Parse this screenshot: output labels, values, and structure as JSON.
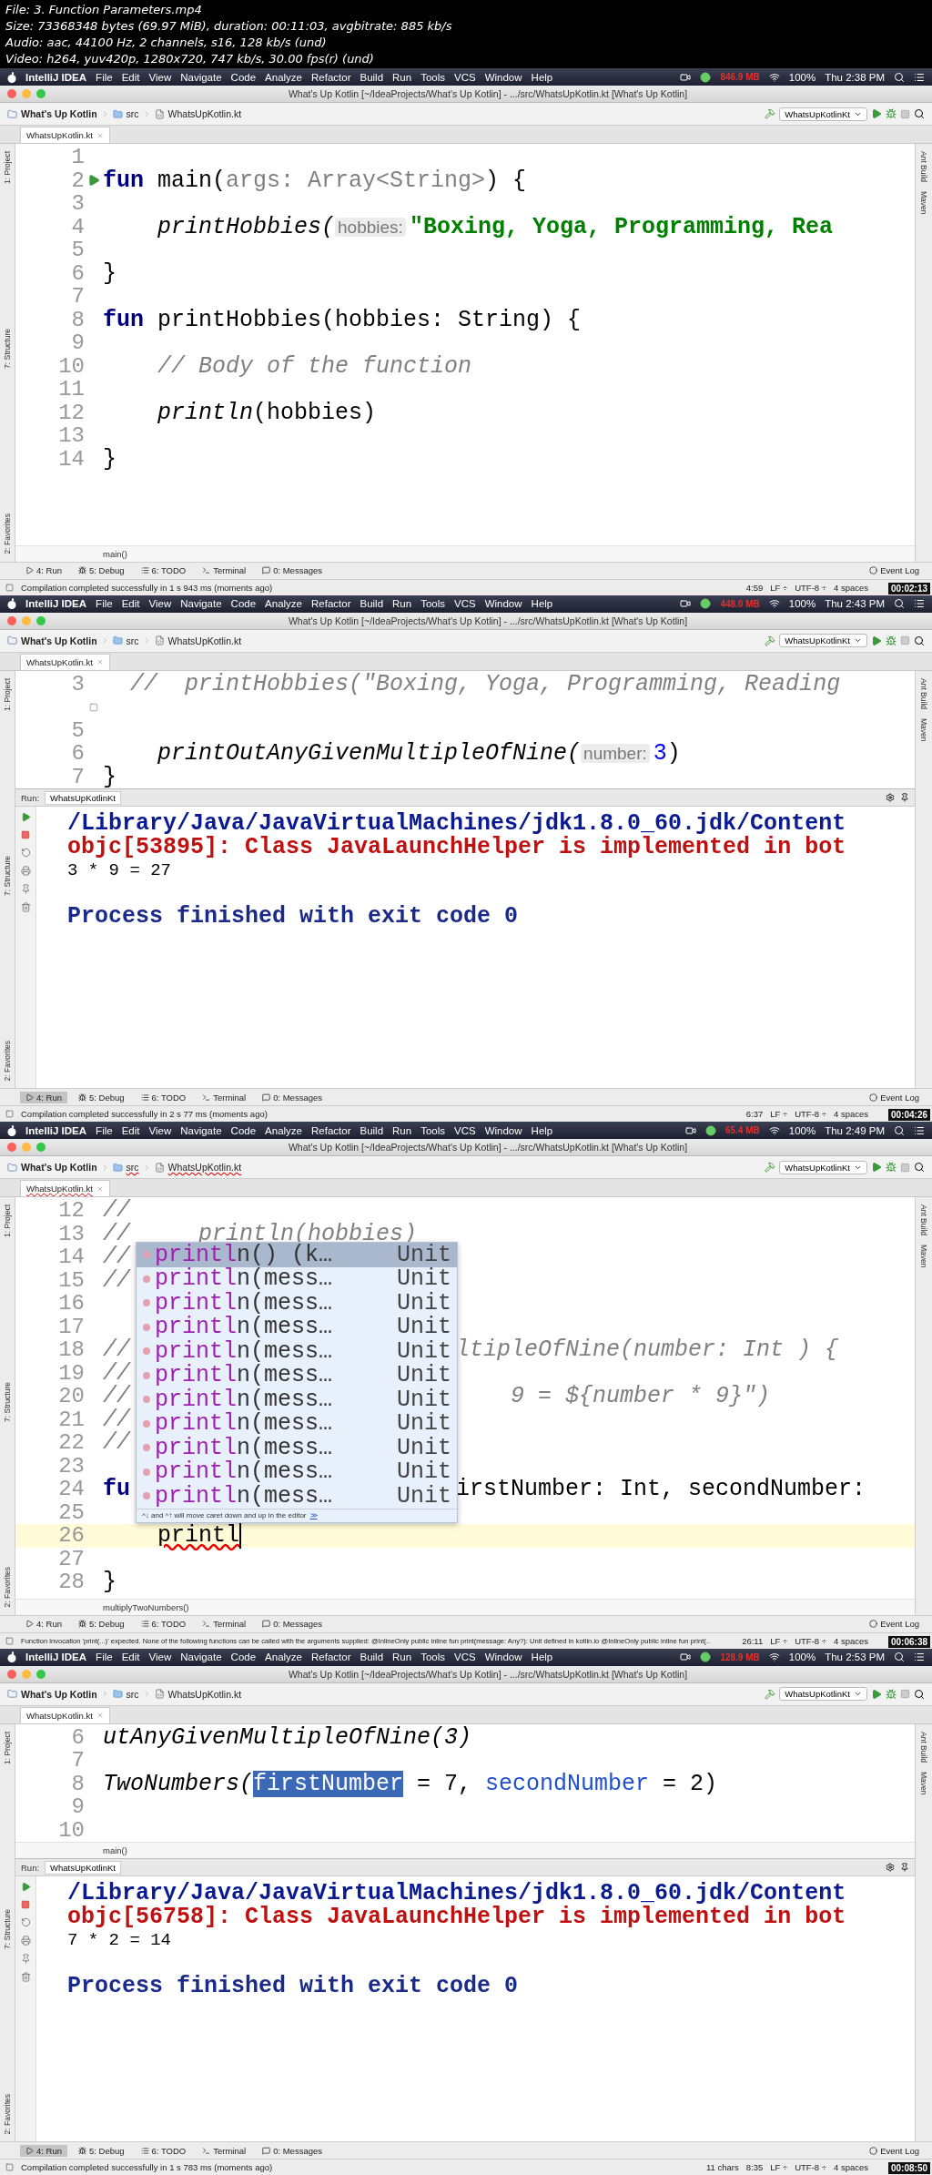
{
  "file_info": [
    "File: 3. Function Parameters.mp4",
    "Size: 73368348 bytes (69.97 MiB), duration: 00:11:03, avgbitrate: 885 kb/s",
    "Audio: aac, 44100 Hz, 2 channels, s16, 128 kb/s (und)",
    "Video: h264, yuv420p, 1280x720, 747 kb/s, 30.00 fps(r) (und)"
  ],
  "frames": [
    {
      "menu_bar": {
        "app": "IntelliJ IDEA",
        "menus": [
          "File",
          "Edit",
          "View",
          "Navigate",
          "Code",
          "Analyze",
          "Refactor",
          "Build",
          "Run",
          "Tools",
          "VCS",
          "Window",
          "Help"
        ],
        "memory": "846.9 MB",
        "battery": "100%",
        "clock": "Thu 2:38 PM"
      },
      "window_title": "What's Up Kotlin [~/IdeaProjects/What's Up Kotlin] - .../src/WhatsUpKotlin.kt [What's Up Kotlin]",
      "nav": {
        "crumbs": [
          {
            "label": "What's Up Kotlin",
            "kind": "project"
          },
          {
            "label": "src",
            "kind": "folder"
          },
          {
            "label": "WhatsUpKotlin.kt",
            "kind": "file"
          }
        ],
        "error": false,
        "run_config": "WhatsUpKotlinKt"
      },
      "tab": {
        "label": "WhatsUpKotlin.kt",
        "error": false
      },
      "side_left": [
        "1: Project",
        "7: Structure",
        "2: Favorites"
      ],
      "side_right": [
        "Ant Build",
        "Maven"
      ],
      "editor": {
        "lines": [
          {
            "number": "1"
          },
          {
            "number": "2",
            "run_marker": true,
            "tokens": [
              {
                "t": "fun ",
                "kind": "kw"
              },
              {
                "t": "main(",
                "kind": "plain"
              },
              {
                "t": "args: Array<String>",
                "kind": "unused"
              },
              {
                "t": ") {",
                "kind": "plain"
              }
            ]
          },
          {
            "number": "3"
          },
          {
            "number": "4",
            "tokens": [
              {
                "t": "    printHobbies(",
                "kind": "call"
              },
              {
                "t": "hobbies:",
                "kind": "hint"
              },
              {
                "t": "\"Boxing, Yoga, Programming, Rea",
                "kind": "str"
              }
            ]
          },
          {
            "number": "5"
          },
          {
            "number": "6",
            "tokens": [
              {
                "t": "}",
                "kind": "plain"
              }
            ]
          },
          {
            "number": "7"
          },
          {
            "number": "8",
            "tokens": [
              {
                "t": "fun ",
                "kind": "kw"
              },
              {
                "t": "printHobbies(hobbies: String) {",
                "kind": "plain"
              }
            ]
          },
          {
            "number": "9"
          },
          {
            "number": "10",
            "tokens": [
              {
                "t": "    // Body of the function",
                "kind": "comment"
              }
            ]
          },
          {
            "number": "11"
          },
          {
            "number": "12",
            "tokens": [
              {
                "t": "    println",
                "kind": "call"
              },
              {
                "t": "(hobbies)",
                "kind": "plain"
              }
            ]
          },
          {
            "number": "13"
          },
          {
            "number": "14",
            "tokens": [
              {
                "t": "}",
                "kind": "plain"
              }
            ]
          }
        ],
        "footer": "main()"
      },
      "tool_windows": [
        {
          "label": "4: Run",
          "kind": "run",
          "selected": false
        },
        {
          "label": "5: Debug",
          "kind": "debug",
          "selected": false
        },
        {
          "label": "6: TODO",
          "kind": "todo",
          "selected": false
        },
        {
          "label": "Terminal",
          "kind": "terminal",
          "selected": false
        },
        {
          "label": "0: Messages",
          "kind": "messages",
          "selected": false
        }
      ],
      "event_log": "Event Log",
      "status": {
        "message": "Compilation completed successfully in 1 s 943 ms (moments ago)",
        "items": [
          "4:59",
          "LF ÷",
          "UTF-8 ÷",
          "4 spaces"
        ]
      },
      "timestamp": "00:02:13"
    },
    {
      "menu_bar": {
        "app": "IntelliJ IDEA",
        "menus": [
          "File",
          "Edit",
          "View",
          "Navigate",
          "Code",
          "Analyze",
          "Refactor",
          "Build",
          "Run",
          "Tools",
          "VCS",
          "Window",
          "Help"
        ],
        "memory": "448.0 MB",
        "battery": "100%",
        "clock": "Thu 2:43 PM"
      },
      "window_title": "What's Up Kotlin [~/IdeaProjects/What's Up Kotlin] - .../src/WhatsUpKotlin.kt [What's Up Kotlin]",
      "nav": {
        "crumbs": [
          {
            "label": "What's Up Kotlin",
            "kind": "project"
          },
          {
            "label": "src",
            "kind": "folder"
          },
          {
            "label": "WhatsUpKotlin.kt",
            "kind": "file"
          }
        ],
        "error": false,
        "run_config": "WhatsUpKotlinKt"
      },
      "tab": {
        "label": "WhatsUpKotlin.kt",
        "error": false
      },
      "side_left": [
        "1: Project",
        "7: Structure",
        "2: Favorites"
      ],
      "side_right": [
        "Ant Build",
        "Maven"
      ],
      "editor": {
        "lines": [
          {
            "number": "3",
            "tokens": [
              {
                "t": "  //  printHobbies(\"Boxing, Yoga, Programming, Reading",
                "kind": "comment"
              }
            ]
          },
          {
            "fold_marker": true
          },
          {
            "number": "5"
          },
          {
            "number": "6",
            "tokens": [
              {
                "t": "    printOutAnyGivenMultipleOfNine(",
                "kind": "call"
              },
              {
                "t": "number:",
                "kind": "hint"
              },
              {
                "t": "3",
                "kind": "num"
              },
              {
                "t": ")",
                "kind": "plain"
              }
            ]
          },
          {
            "number": "7",
            "tokens": [
              {
                "t": "}",
                "kind": "plain"
              }
            ]
          }
        ]
      },
      "run_panel": {
        "label": "Run:",
        "tab": "WhatsUpKotlinKt",
        "console": [
          {
            "t": "/Library/Java/JavaVirtualMachines/jdk1.8.0_60.jdk/Content",
            "kind": "path"
          },
          {
            "t": "objc[53895]: Class JavaLaunchHelper is implemented in bot",
            "kind": "error"
          },
          {
            "t": "3 * 9 = 27",
            "kind": "output"
          },
          {
            "kind": "blank"
          },
          {
            "t": "Process finished with exit code 0",
            "kind": "exit"
          }
        ]
      },
      "tool_windows": [
        {
          "label": "4: Run",
          "kind": "run",
          "selected": true
        },
        {
          "label": "5: Debug",
          "kind": "debug",
          "selected": false
        },
        {
          "label": "6: TODO",
          "kind": "todo",
          "selected": false
        },
        {
          "label": "Terminal",
          "kind": "terminal",
          "selected": false
        },
        {
          "label": "0: Messages",
          "kind": "messages",
          "selected": false
        }
      ],
      "event_log": "Event Log",
      "status": {
        "message": "Compilation completed successfully in 2 s 77 ms (moments ago)",
        "items": [
          "6:37",
          "LF ÷",
          "UTF-8 ÷",
          "4 spaces"
        ]
      },
      "timestamp": "00:04:26"
    },
    {
      "menu_bar": {
        "app": "IntelliJ IDEA",
        "menus": [
          "File",
          "Edit",
          "View",
          "Navigate",
          "Code",
          "Analyze",
          "Refactor",
          "Build",
          "Run",
          "Tools",
          "VCS",
          "Window",
          "Help"
        ],
        "memory": "65.4 MB",
        "battery": "100%",
        "clock": "Thu 2:49 PM"
      },
      "window_title": "What's Up Kotlin [~/IdeaProjects/What's Up Kotlin] - .../src/WhatsUpKotlin.kt [What's Up Kotlin]",
      "nav": {
        "crumbs": [
          {
            "label": "What's Up Kotlin",
            "kind": "project"
          },
          {
            "label": "src",
            "kind": "folder"
          },
          {
            "label": "WhatsUpKotlin.kt",
            "kind": "file"
          }
        ],
        "error": true,
        "run_config": "WhatsUpKotlinKt"
      },
      "tab": {
        "label": "WhatsUpKotlin.kt",
        "error": true
      },
      "side_left": [
        "1: Project",
        "7: Structure",
        "2: Favorites"
      ],
      "side_right": [
        "Ant Build",
        "Maven"
      ],
      "editor": {
        "lines": [
          {
            "number": "12",
            "tokens": [
              {
                "t": "//",
                "kind": "comment"
              }
            ]
          },
          {
            "number": "13",
            "tokens": [
              {
                "t": "//     println(hobbies)",
                "kind": "comment"
              }
            ]
          },
          {
            "number": "14",
            "tokens": [
              {
                "t": "//",
                "kind": "comment"
              }
            ]
          },
          {
            "number": "15",
            "tokens": [
              {
                "t": "//",
                "kind": "comment"
              }
            ]
          },
          {
            "number": "16"
          },
          {
            "number": "17"
          },
          {
            "number": "18",
            "tokens": [
              {
                "t": "//",
                "kind": "comment"
              }
            ],
            "right": [
              {
                "t": "ltipleOfNine(number: Int ) {",
                "kind": "comment"
              }
            ]
          },
          {
            "number": "19",
            "tokens": [
              {
                "t": "//",
                "kind": "comment"
              }
            ]
          },
          {
            "number": "20",
            "tokens": [
              {
                "t": "//",
                "kind": "comment"
              }
            ],
            "right": [
              {
                "t": "    9 = ${number * 9}\")",
                "kind": "comment"
              }
            ]
          },
          {
            "number": "21",
            "tokens": [
              {
                "t": "//",
                "kind": "comment"
              }
            ]
          },
          {
            "number": "22",
            "tokens": [
              {
                "t": "//",
                "kind": "comment"
              }
            ]
          },
          {
            "number": "23"
          },
          {
            "number": "24",
            "tokens": [
              {
                "t": "fu",
                "kind": "kw"
              }
            ],
            "right": [
              {
                "t": "irstNumber: Int, secondNumber:",
                "kind": "plain"
              }
            ]
          },
          {
            "number": "25"
          },
          {
            "number": "26",
            "current": true,
            "indented": true,
            "tokens": [
              {
                "t": "printl",
                "kind": "err"
              }
            ]
          },
          {
            "number": "27"
          },
          {
            "number": "28",
            "tokens": [
              {
                "t": "}",
                "kind": "plain"
              }
            ]
          }
        ],
        "footer": "multiplyTwoNumbers()",
        "popup": {
          "items": [
            {
              "match": "printl",
              "rest": "n() (k…",
              "type": "Unit",
              "selected": true
            },
            {
              "match": "printl",
              "rest": "n(mess…",
              "type": "Unit",
              "selected": false
            },
            {
              "match": "printl",
              "rest": "n(mess…",
              "type": "Unit",
              "selected": false
            },
            {
              "match": "printl",
              "rest": "n(mess…",
              "type": "Unit",
              "selected": false
            },
            {
              "match": "printl",
              "rest": "n(mess…",
              "type": "Unit",
              "selected": false
            },
            {
              "match": "printl",
              "rest": "n(mess…",
              "type": "Unit",
              "selected": false
            },
            {
              "match": "printl",
              "rest": "n(mess…",
              "type": "Unit",
              "selected": false
            },
            {
              "match": "printl",
              "rest": "n(mess…",
              "type": "Unit",
              "selected": false
            },
            {
              "match": "printl",
              "rest": "n(mess…",
              "type": "Unit",
              "selected": false
            },
            {
              "match": "printl",
              "rest": "n(mess…",
              "type": "Unit",
              "selected": false
            },
            {
              "match": "printl",
              "rest": "n(mess…",
              "type": "Unit",
              "selected": false
            }
          ],
          "hint": "^↓ and ^↑ will move caret down and up in the editor",
          "more": "≫"
        }
      },
      "tool_windows": [
        {
          "label": "4: Run",
          "kind": "run",
          "selected": false
        },
        {
          "label": "5: Debug",
          "kind": "debug",
          "selected": false
        },
        {
          "label": "6: TODO",
          "kind": "todo",
          "selected": false
        },
        {
          "label": "Terminal",
          "kind": "terminal",
          "selected": false
        },
        {
          "label": "0: Messages",
          "kind": "messages",
          "selected": false
        }
      ],
      "event_log": "Event Log",
      "status": {
        "message": "Function invocation 'print(...)' expected. None of the following functions can be called with the arguments supplied:  @InlineOnly public inline fun print(message: Any?): Unit defined in kotlin.io @InlineOnly public inline fun print(..",
        "items": [
          "26:11",
          "LF ÷",
          "UTF-8 ÷",
          "4 spaces"
        ]
      },
      "timestamp": "00:06:38"
    },
    {
      "menu_bar": {
        "app": "IntelliJ IDEA",
        "menus": [
          "File",
          "Edit",
          "View",
          "Navigate",
          "Code",
          "Analyze",
          "Refactor",
          "Build",
          "Run",
          "Tools",
          "VCS",
          "Window",
          "Help"
        ],
        "memory": "128.9 MB",
        "battery": "100%",
        "clock": "Thu 2:53 PM"
      },
      "window_title": "What's Up Kotlin [~/IdeaProjects/What's Up Kotlin] - .../src/WhatsUpKotlin.kt [What's Up Kotlin]",
      "nav": {
        "crumbs": [
          {
            "label": "What's Up Kotlin",
            "kind": "project"
          },
          {
            "label": "src",
            "kind": "folder"
          },
          {
            "label": "WhatsUpKotlin.kt",
            "kind": "file"
          }
        ],
        "error": false,
        "run_config": "WhatsUpKotlinKt"
      },
      "tab": {
        "label": "WhatsUpKotlin.kt",
        "error": false
      },
      "side_left": [
        "1: Project",
        "7: Structure",
        "2: Favorites"
      ],
      "side_right": [
        "Ant Build",
        "Maven"
      ],
      "editor": {
        "lines": [
          {
            "number": "6",
            "tokens": [
              {
                "t": "utAnyGivenMultipleOfNine(3)",
                "kind": "call"
              }
            ]
          },
          {
            "number": "7"
          },
          {
            "number": "8",
            "tokens": [
              {
                "t": "TwoNumbers(",
                "kind": "call"
              },
              {
                "t": "firstNumber",
                "kind": "sel"
              },
              {
                "t": " = 7, ",
                "kind": "plain"
              },
              {
                "t": "secondNumber",
                "kind": "param"
              },
              {
                "t": " = 2)",
                "kind": "plain"
              }
            ]
          },
          {
            "number": "9"
          },
          {
            "number": "10"
          }
        ],
        "footer": "main()"
      },
      "run_panel": {
        "label": "Run:",
        "tab": "WhatsUpKotlinKt",
        "console": [
          {
            "t": "/Library/Java/JavaVirtualMachines/jdk1.8.0_60.jdk/Content",
            "kind": "path"
          },
          {
            "t": "objc[56758]: Class JavaLaunchHelper is implemented in bot",
            "kind": "error"
          },
          {
            "t": "7 * 2 = 14",
            "kind": "output"
          },
          {
            "kind": "blank"
          },
          {
            "t": "Process finished with exit code 0",
            "kind": "exit"
          }
        ]
      },
      "tool_windows": [
        {
          "label": "4: Run",
          "kind": "run",
          "selected": true
        },
        {
          "label": "5: Debug",
          "kind": "debug",
          "selected": false
        },
        {
          "label": "6: TODO",
          "kind": "todo",
          "selected": false
        },
        {
          "label": "Terminal",
          "kind": "terminal",
          "selected": false
        },
        {
          "label": "0: Messages",
          "kind": "messages",
          "selected": false
        }
      ],
      "event_log": "Event Log",
      "status": {
        "message": "Compilation completed successfully in 1 s 783 ms (moments ago)",
        "chars": "11 chars",
        "items": [
          "8:35",
          "LF ÷",
          "UTF-8 ÷",
          "4 spaces"
        ]
      },
      "timestamp": "00:08:50"
    }
  ]
}
